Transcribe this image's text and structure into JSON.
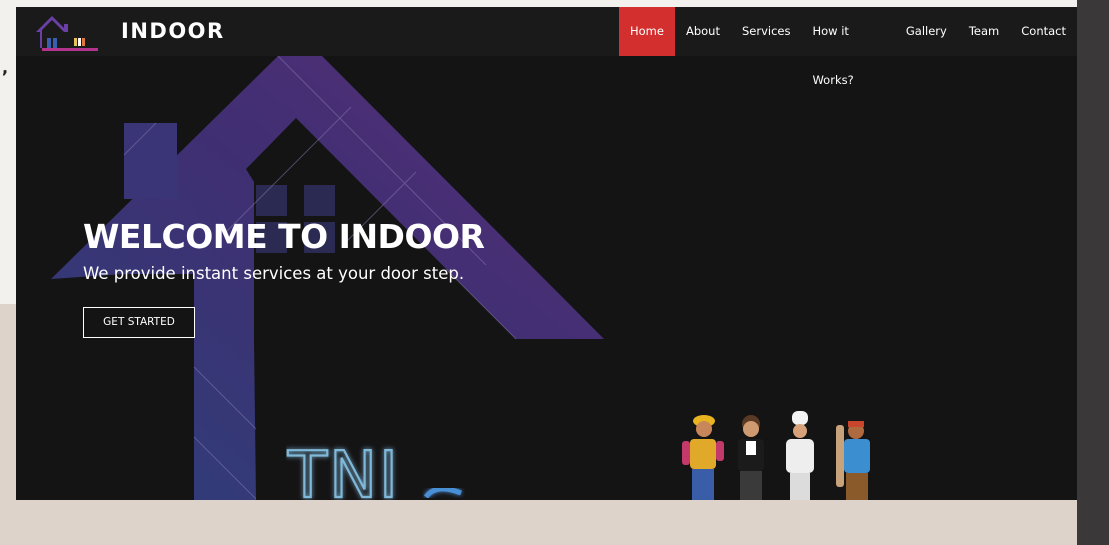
{
  "site": {
    "brand": "INDOOR",
    "logo_text": "Indoor"
  },
  "nav": {
    "items": [
      {
        "label": "Home",
        "active": true
      },
      {
        "label": "About"
      },
      {
        "label": "Services"
      },
      {
        "label": "How it Works?"
      },
      {
        "label": "Gallery"
      },
      {
        "label": "Team"
      },
      {
        "label": "Contact"
      }
    ]
  },
  "hero": {
    "title": "WELCOME TO INDOOR",
    "subtitle": "We provide instant services at your door step.",
    "cta_label": "GET STARTED",
    "neon_text": "TNI"
  },
  "stray_text": ",",
  "colors": {
    "accent": "#d42f2f",
    "hero_bg": "#151415",
    "house_purple": "#4e2d6d",
    "house_blue": "#2e3f7a"
  },
  "icons": [
    "house-logo-icon",
    "workers-illustration"
  ]
}
